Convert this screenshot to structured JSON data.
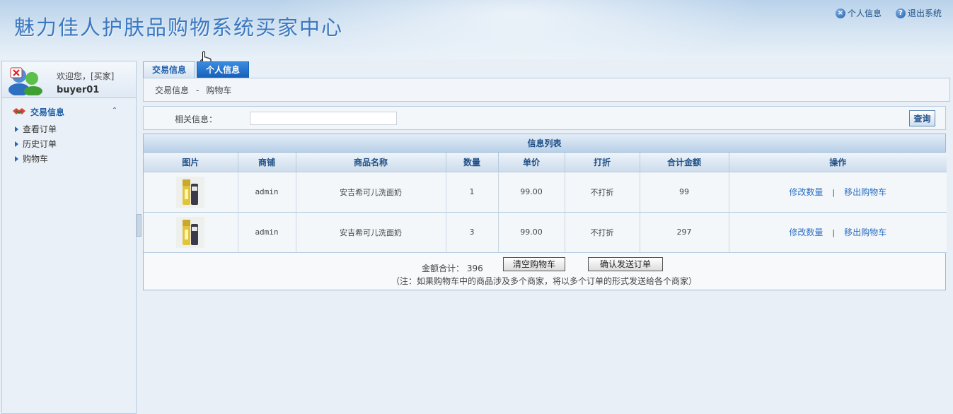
{
  "header": {
    "title": "魅力佳人护肤品购物系统买家中心",
    "links": [
      {
        "label": "个人信息",
        "icon": "x-circle-icon"
      },
      {
        "label": "退出系统",
        "icon": "question-circle-icon"
      }
    ]
  },
  "sidebar": {
    "welcome": "欢迎您，[买家]",
    "username": "buyer01",
    "section_title": "交易信息",
    "items": [
      {
        "label": "查看订单"
      },
      {
        "label": "历史订单"
      },
      {
        "label": "购物车"
      }
    ]
  },
  "tabs": [
    {
      "label": "交易信息",
      "active": false
    },
    {
      "label": "个人信息",
      "active": true
    }
  ],
  "breadcrumb": [
    "交易信息",
    "-",
    "购物车"
  ],
  "search": {
    "label": "相关信息：",
    "value": "",
    "button": "查询"
  },
  "list": {
    "title": "信息列表",
    "columns": [
      "图片",
      "商铺",
      "商品名称",
      "数量",
      "单价",
      "打折",
      "合计金额",
      "操作"
    ],
    "rows": [
      {
        "shop": "admin",
        "product": "安吉希可儿洗面奶",
        "qty": "1",
        "price": "99.00",
        "discount": "不打折",
        "subtotal": "99",
        "op_edit": "修改数量",
        "op_sep": "|",
        "op_remove": "移出购物车"
      },
      {
        "shop": "admin",
        "product": "安吉希可儿洗面奶",
        "qty": "3",
        "price": "99.00",
        "discount": "不打折",
        "subtotal": "297",
        "op_edit": "修改数量",
        "op_sep": "|",
        "op_remove": "移出购物车"
      }
    ],
    "total_label": "金额合计：",
    "total_value": "396",
    "clear_button": "清空购物车",
    "confirm_button": "确认发送订单",
    "note": "（注：如果购物车中的商品涉及多个商家，将以多个订单的形式发送给各个商家）"
  },
  "colors": {
    "title_blue": "#3b78c0",
    "link_blue": "#2a6fc2",
    "active_tab": "#1660b8"
  }
}
